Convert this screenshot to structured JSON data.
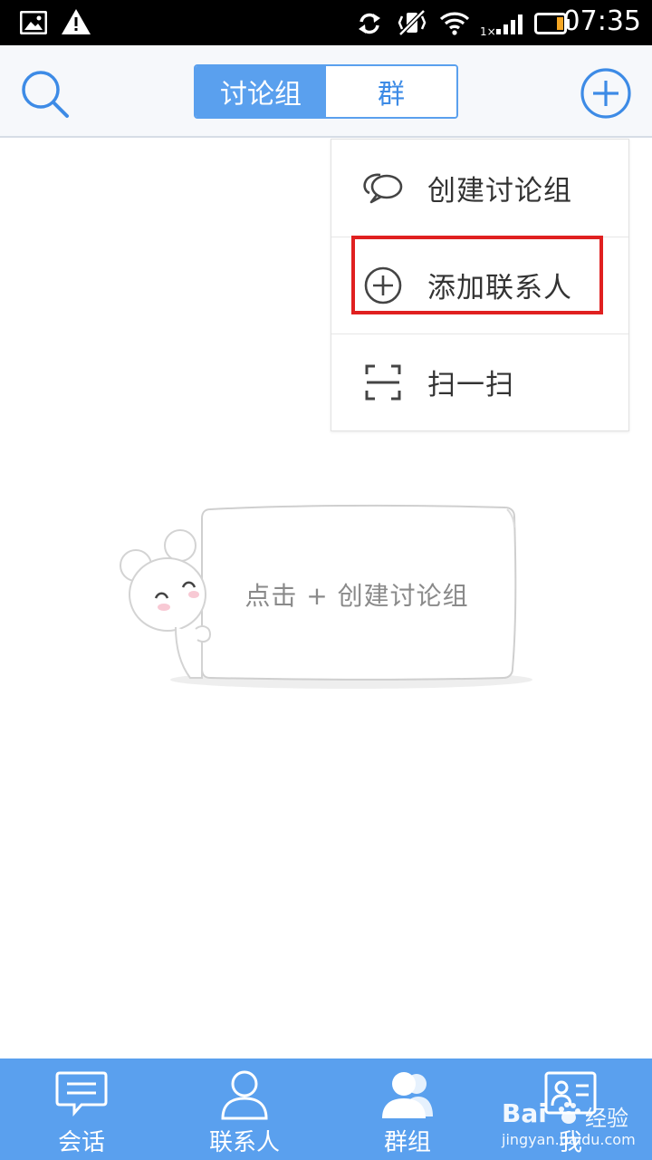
{
  "status_bar": {
    "time": "07:35",
    "icons": [
      "image-icon",
      "warning-icon",
      "sync-icon",
      "vibrate-off-icon",
      "wifi-icon",
      "signal-icon",
      "battery-icon"
    ],
    "sim_label": "1×"
  },
  "header": {
    "search_icon": "search-icon",
    "tabs": [
      {
        "label": "讨论组",
        "active": true
      },
      {
        "label": "群",
        "active": false
      }
    ],
    "add_icon": "plus-circle-icon"
  },
  "popup_menu": {
    "items": [
      {
        "label": "创建讨论组",
        "icon": "chat-bubbles-icon"
      },
      {
        "label": "添加联系人",
        "icon": "plus-circle-icon",
        "highlighted": true
      },
      {
        "label": "扫一扫",
        "icon": "scan-icon"
      }
    ]
  },
  "empty_state": {
    "text": "点击 + 创建讨论组"
  },
  "bottom_nav": {
    "items": [
      {
        "label": "会话",
        "icon": "message-icon"
      },
      {
        "label": "联系人",
        "icon": "person-icon"
      },
      {
        "label": "群组",
        "icon": "group-icon"
      },
      {
        "label": "我",
        "icon": "profile-card-icon"
      }
    ]
  },
  "watermark": {
    "brand": "Bai",
    "brand_suffix": "经验",
    "url": "jingyan.baidu.com"
  },
  "colors": {
    "accent": "#5aa0ee",
    "highlight_border": "#e02020",
    "status_bar": "#000000"
  }
}
